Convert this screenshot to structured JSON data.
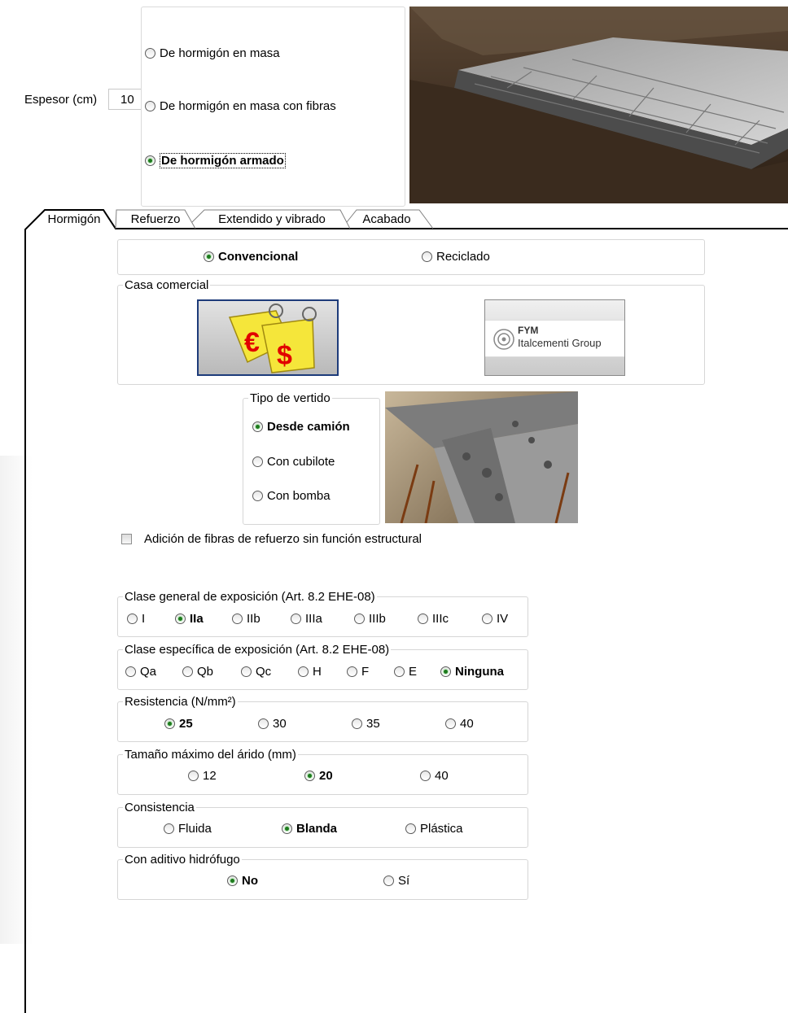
{
  "espesor": {
    "label": "Espesor (cm)",
    "value": "10"
  },
  "tipo_solera": {
    "options": [
      {
        "label": "De hormigón en masa",
        "selected": false
      },
      {
        "label": "De hormigón en masa con fibras",
        "selected": false
      },
      {
        "label": "De hormigón armado",
        "selected": true
      }
    ]
  },
  "tabs": [
    {
      "label": "Hormigón",
      "active": true
    },
    {
      "label": "Refuerzo",
      "active": false
    },
    {
      "label": "Extendido y vibrado",
      "active": false
    },
    {
      "label": "Acabado",
      "active": false
    }
  ],
  "hormigon_tipo": {
    "options": [
      "Convencional",
      "Reciclado"
    ],
    "selected": "Convencional"
  },
  "casa_comercial": {
    "title": "Casa comercial",
    "fym_line1": "FYM",
    "fym_line2": "Italcementi Group"
  },
  "tipo_vertido": {
    "title": "Tipo de vertido",
    "options": [
      "Desde camión",
      "Con cubilote",
      "Con bomba"
    ],
    "selected": "Desde camión"
  },
  "fibras_checkbox": {
    "label": "Adición de fibras de refuerzo sin función estructural",
    "checked": false
  },
  "clase_general": {
    "title": "Clase general de exposición (Art. 8.2 EHE-08)",
    "options": [
      "I",
      "IIa",
      "IIb",
      "IIIa",
      "IIIb",
      "IIIc",
      "IV"
    ],
    "selected": "IIa"
  },
  "clase_especifica": {
    "title": "Clase específica de exposición (Art. 8.2 EHE-08)",
    "options": [
      "Qa",
      "Qb",
      "Qc",
      "H",
      "F",
      "E",
      "Ninguna"
    ],
    "selected": "Ninguna"
  },
  "resistencia": {
    "title": "Resistencia (N/mm²)",
    "options": [
      "25",
      "30",
      "35",
      "40"
    ],
    "selected": "25"
  },
  "arido": {
    "title": "Tamaño máximo del árido (mm)",
    "options": [
      "12",
      "20",
      "40"
    ],
    "selected": "20"
  },
  "consistencia": {
    "title": "Consistencia",
    "options": [
      "Fluida",
      "Blanda",
      "Plástica"
    ],
    "selected": "Blanda"
  },
  "hidrofugo": {
    "title": "Con aditivo hidrófugo",
    "options": [
      "No",
      "Sí"
    ],
    "selected": "No"
  },
  "colors": {
    "radio_selected": "#1e7a1e",
    "border": "#d6d6d6",
    "dark_frame": "#000000"
  }
}
